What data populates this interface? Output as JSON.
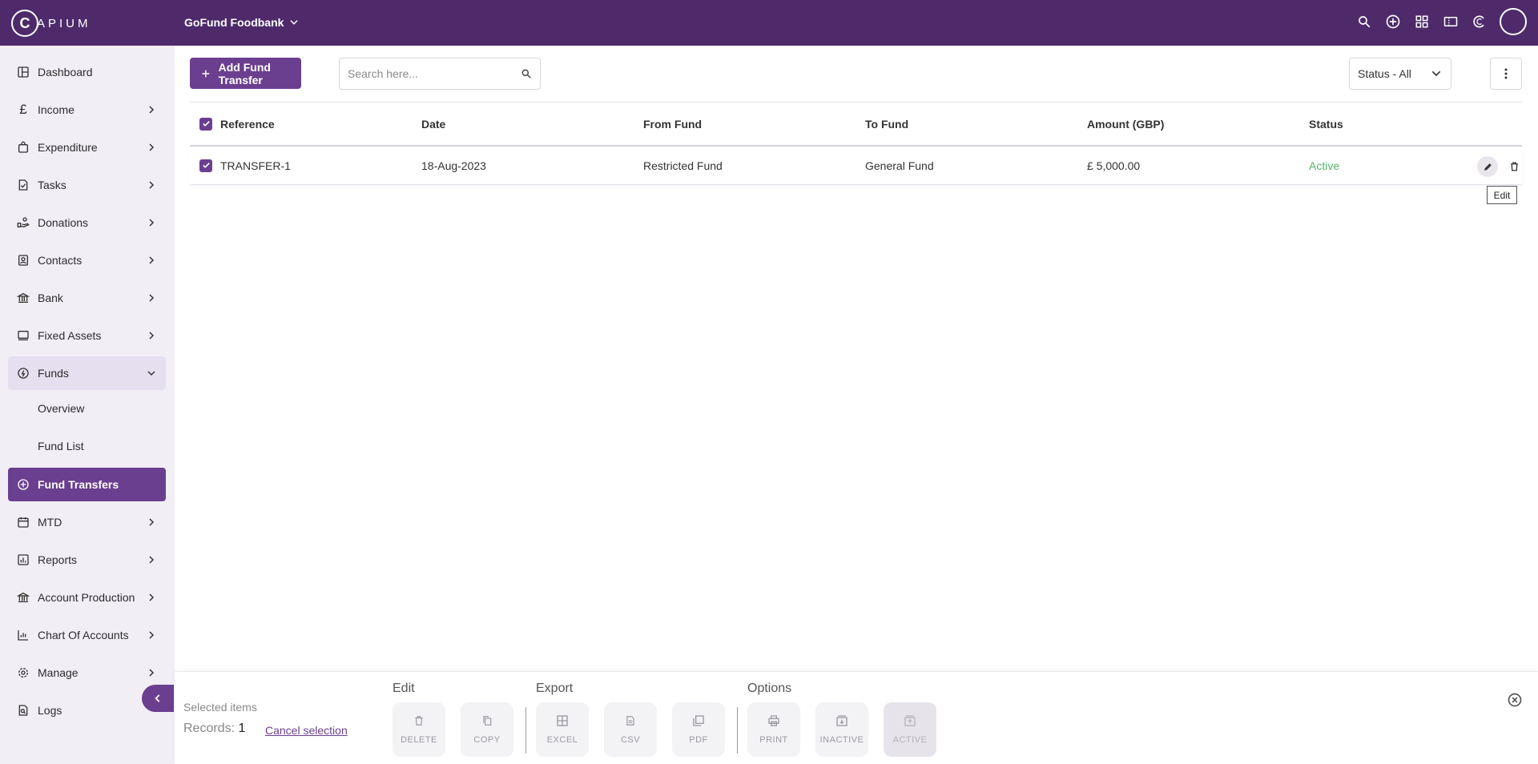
{
  "app": {
    "logo_letter": "C",
    "logo_text": "APIUM",
    "org_name": "GoFund Foodbank",
    "top_icons": [
      "search-icon",
      "add-circle-icon",
      "apps-icon",
      "ticket-icon",
      "capium-icon",
      "avatar"
    ]
  },
  "sidebar": {
    "items": [
      {
        "label": "Dashboard",
        "icon": "dashboard-icon"
      },
      {
        "label": "Income",
        "icon": "pound-icon"
      },
      {
        "label": "Expenditure",
        "icon": "bag-icon"
      },
      {
        "label": "Tasks",
        "icon": "tasks-icon"
      },
      {
        "label": "Donations",
        "icon": "donations-icon"
      },
      {
        "label": "Contacts",
        "icon": "contacts-icon"
      },
      {
        "label": "Bank",
        "icon": "bank-icon"
      },
      {
        "label": "Fixed Assets",
        "icon": "fixed-assets-icon"
      },
      {
        "label": "Funds",
        "icon": "funds-icon"
      },
      {
        "label": "Overview"
      },
      {
        "label": "Fund List"
      },
      {
        "label": "Fund Transfers",
        "icon": "fund-transfers-icon"
      },
      {
        "label": "MTD",
        "icon": "calendar-icon"
      },
      {
        "label": "Reports",
        "icon": "reports-icon"
      },
      {
        "label": "Account Production",
        "icon": "account-production-icon"
      },
      {
        "label": "Chart Of Accounts",
        "icon": "chart-icon"
      },
      {
        "label": "Manage",
        "icon": "gear-icon"
      },
      {
        "label": "Logs",
        "icon": "logs-icon"
      }
    ]
  },
  "toolbar": {
    "add_label": "Add Fund Transfer",
    "search_placeholder": "Search here...",
    "status_filter": "Status - All"
  },
  "table": {
    "columns": [
      "Reference",
      "Date",
      "From Fund",
      "To Fund",
      "Amount (GBP)",
      "Status"
    ],
    "rows": [
      {
        "reference": "TRANSFER-1",
        "date": "18-Aug-2023",
        "from_fund": "Restricted Fund",
        "to_fund": "General Fund",
        "amount": "£ 5,000.00",
        "status": "Active"
      }
    ],
    "edit_tooltip": "Edit"
  },
  "bottom_bar": {
    "selected_label": "Selected items",
    "records_label": "Records:",
    "records_count": "1",
    "cancel_label": "Cancel selection",
    "groups": {
      "edit": "Edit",
      "export": "Export",
      "options": "Options"
    },
    "actions": {
      "delete": "DELETE",
      "copy": "COPY",
      "excel": "EXCEL",
      "csv": "CSV",
      "pdf": "PDF",
      "print": "PRINT",
      "inactive": "INACTIVE",
      "active": "ACTIVE"
    }
  },
  "colors": {
    "brand": "#4e2a6b",
    "accent": "#6b3f8f",
    "status_active": "#52b36b"
  }
}
